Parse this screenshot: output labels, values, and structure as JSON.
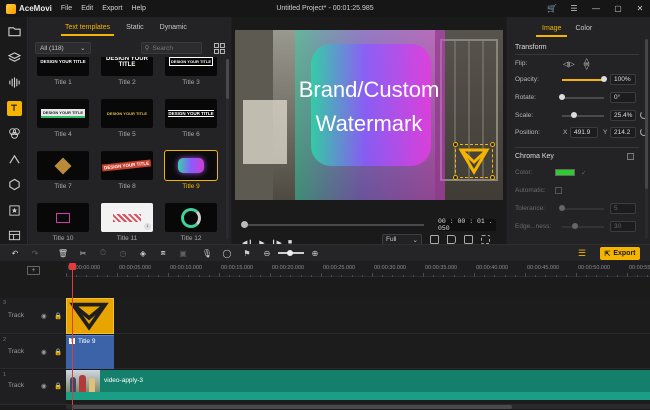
{
  "app": {
    "name": "AceMovi",
    "menu": [
      "File",
      "Edit",
      "Export",
      "Help"
    ],
    "project_title": "Untitled Project* - 00:01:25.985"
  },
  "library": {
    "tabs": [
      "Text templates",
      "Static",
      "Dynamic"
    ],
    "active_tab": "Text templates",
    "filter_value": "All (118)",
    "search_placeholder": "Search",
    "thumb_text": {
      "t1": "DESIGN YOUR TITLE",
      "t2": "DESIGN YOUR TITLE",
      "t3": "DESIGN YOUR TITLE",
      "t4": "DESIGN YOUR TITLE",
      "t5": "DESIGN YOUR TITLE",
      "t6": "DESIGN YOUR TITLE",
      "t8": "DESIGN YOUR TITLE"
    },
    "items": [
      {
        "label": "Title 1"
      },
      {
        "label": "Title 2"
      },
      {
        "label": "Title 3"
      },
      {
        "label": "Title 4"
      },
      {
        "label": "Title 5"
      },
      {
        "label": "Title 6"
      },
      {
        "label": "Title 7"
      },
      {
        "label": "Title 8"
      },
      {
        "label": "Title 9",
        "selected": true
      },
      {
        "label": "Title 10"
      },
      {
        "label": "Title 11"
      },
      {
        "label": "Title 12"
      }
    ]
  },
  "preview": {
    "overlay_line1": "Brand/Custom",
    "overlay_line2": "Watermark",
    "timecode": "00 : 00 : 01 . 050",
    "fit_value": "Full"
  },
  "properties": {
    "tabs": [
      "Image",
      "Color"
    ],
    "active_tab": "Image",
    "transform_heading": "Transform",
    "flip_label": "Flip:",
    "opacity_label": "Opacity:",
    "opacity_value": "100%",
    "opacity_level": 1.0,
    "rotate_label": "Rotate:",
    "rotate_value": "0°",
    "scale_label": "Scale:",
    "scale_value": "25.4%",
    "position_label": "Position:",
    "pos_x_label": "X",
    "pos_x_value": "491.9",
    "pos_y_label": "Y",
    "pos_y_value": "214.2",
    "chroma_heading": "Chroma Key",
    "color_label": "Color:",
    "chroma_color": "#2ecc2e",
    "automatic_label": "Automatic:",
    "tolerance_label": "Tolerance:",
    "tolerance_value": "5",
    "edge_label": "Edge...ness:",
    "edge_value": "30"
  },
  "toolbar": {
    "export_label": "Export",
    "accent_color": "#f5b400"
  },
  "timeline": {
    "ruler_labels": [
      "00:00:00.000",
      "00:00:05.000",
      "00:00:10.000",
      "00:00:15.000",
      "00:00:20.000",
      "00:00:25.000",
      "00:00:30.000",
      "00:00:35.000",
      "00:00:40.000",
      "00:00:45.000",
      "00:00:50.000",
      "00:00:55.000"
    ],
    "tracks": [
      {
        "num": "3",
        "name": "Track"
      },
      {
        "num": "2",
        "name": "Track"
      },
      {
        "num": "1",
        "name": "Track"
      }
    ],
    "clip_title_label": "Title 9",
    "clip_video_label": "video-apply-3"
  }
}
